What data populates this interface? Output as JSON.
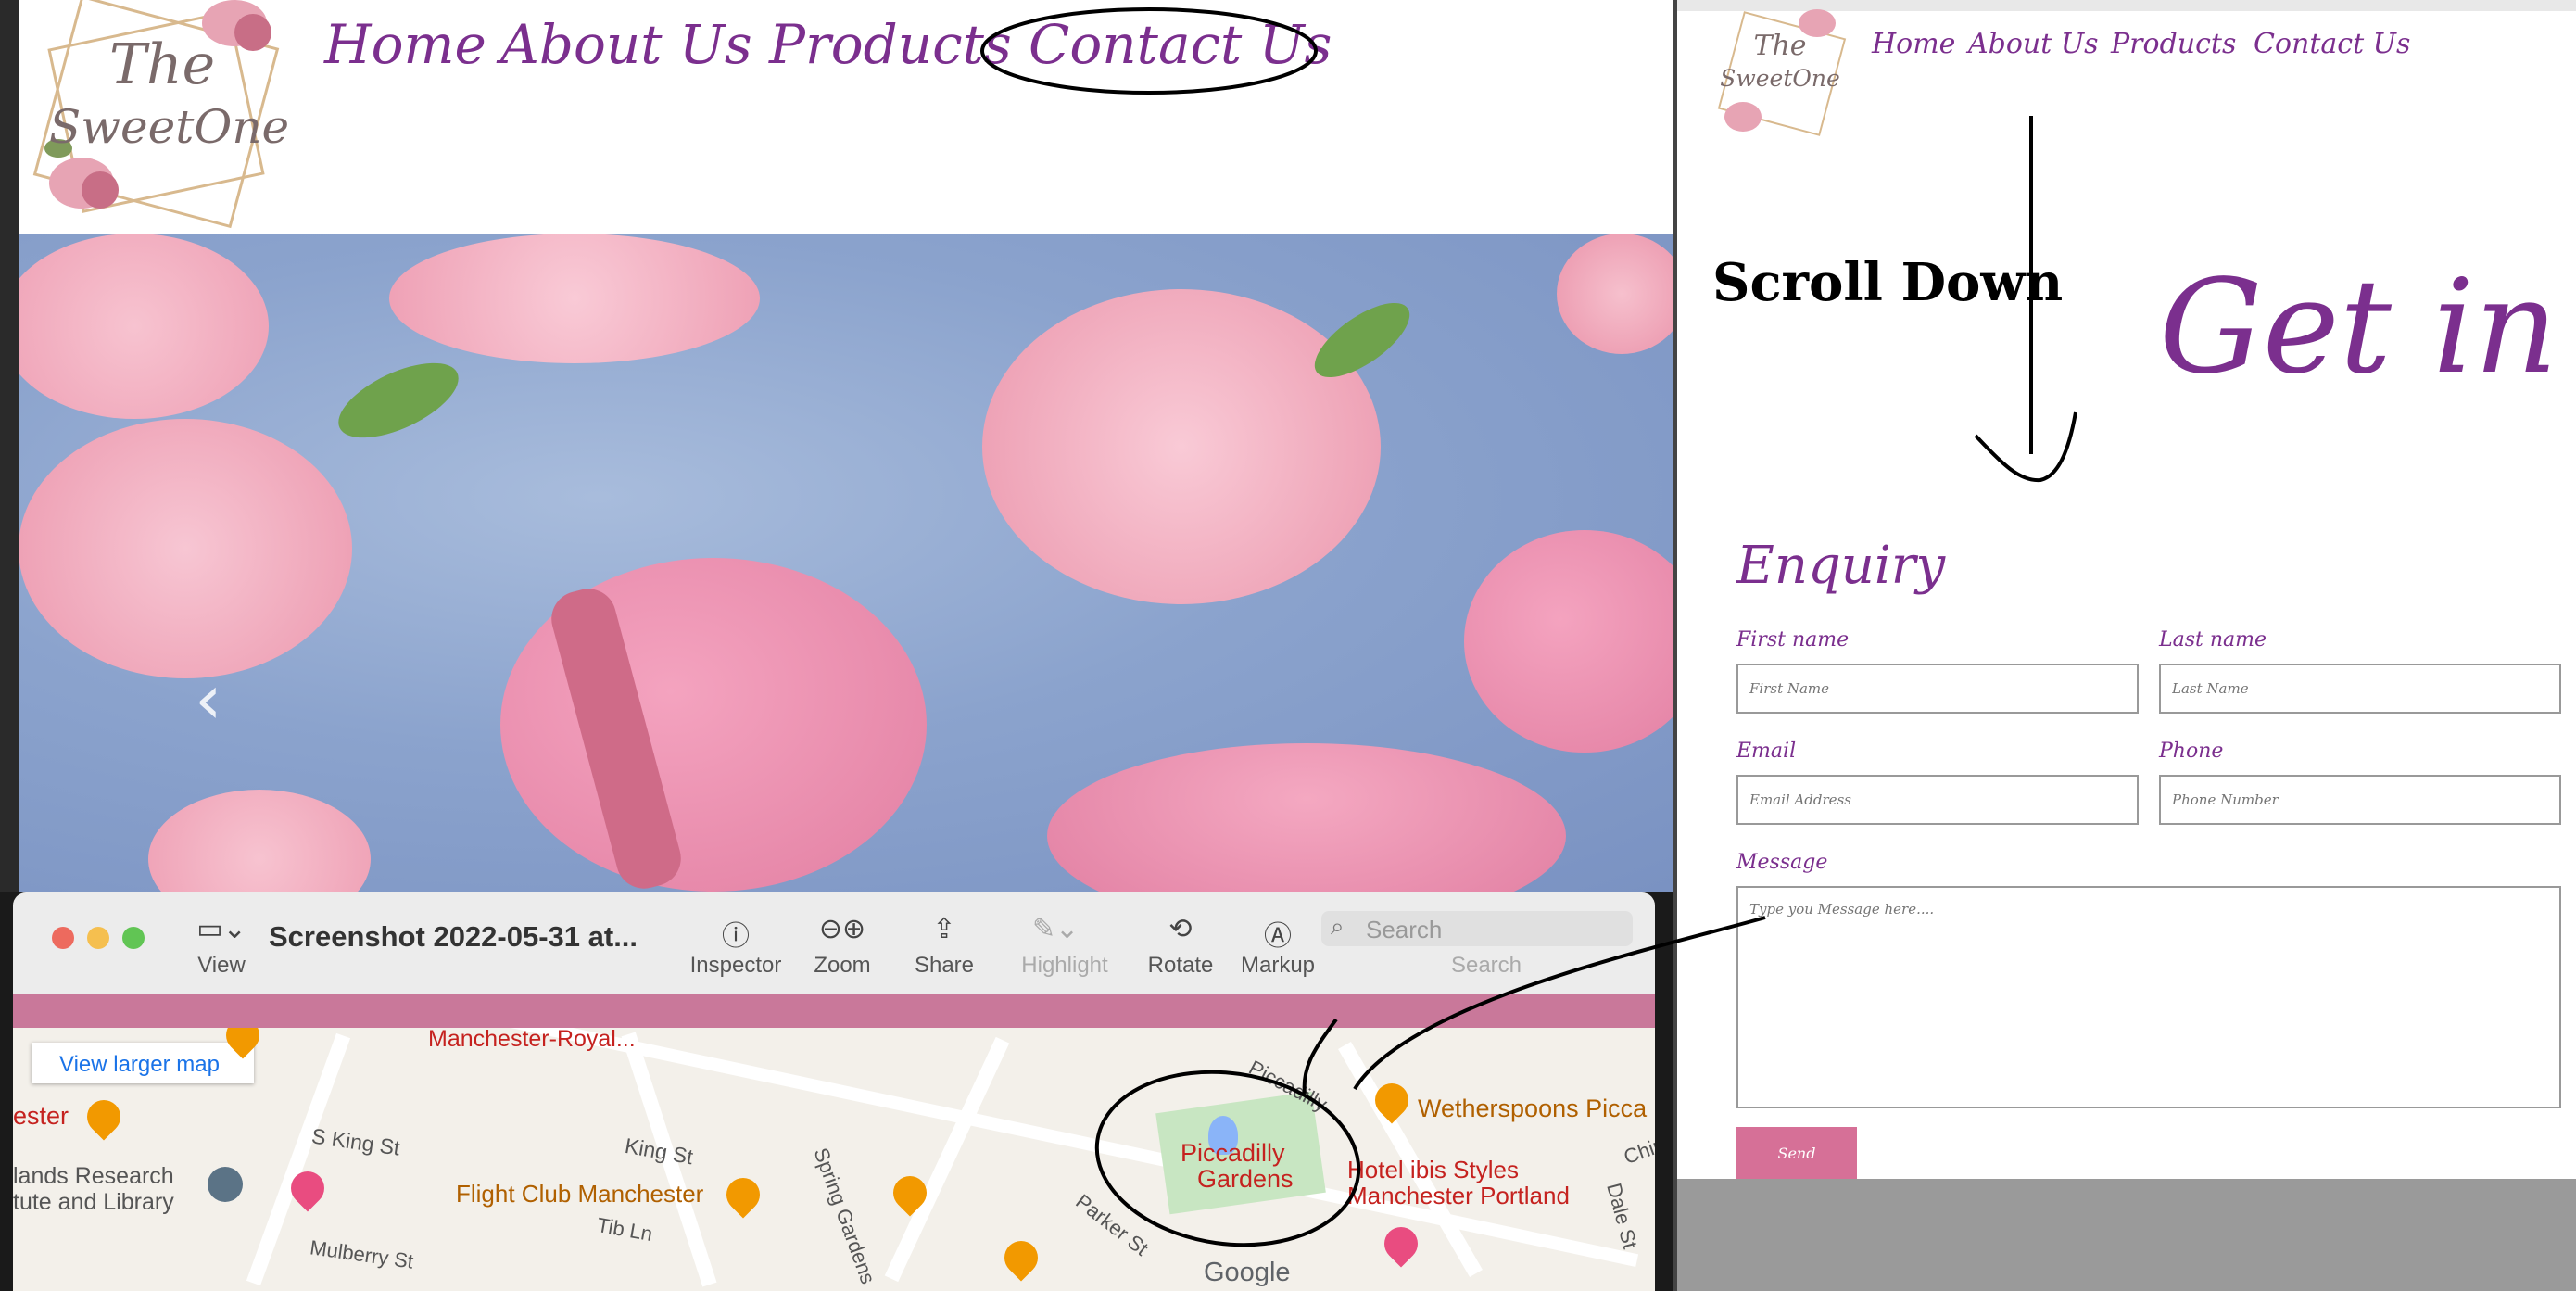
{
  "left_site": {
    "logo_text_line1": "The",
    "logo_text_line2": "SweetOne",
    "nav": [
      {
        "label": "Home"
      },
      {
        "label": "About Us"
      },
      {
        "label": "Products"
      },
      {
        "label": "Contact Us"
      }
    ],
    "carousel_prev_glyph": "‹"
  },
  "preview": {
    "title": "Screenshot 2022-05-31 at...",
    "toolbar": {
      "view": "View",
      "inspector": "Inspector",
      "zoom": "Zoom",
      "share": "Share",
      "highlight": "Highlight",
      "rotate": "Rotate",
      "markup": "Markup",
      "search_label": "Search",
      "search_placeholder": "Search"
    },
    "map": {
      "view_larger": "View larger map",
      "labels": {
        "manchester_royal": "Manchester-Royal...",
        "ester": "ester",
        "s_king": "S King St",
        "king": "King St",
        "flight_club": "Flight Club Manchester",
        "spring_gardens": "Spring Gardens",
        "tib": "Tib Ln",
        "parker": "Parker St",
        "piccadilly": "Piccadilly",
        "piccadilly_gardens_1": "Piccadilly",
        "piccadilly_gardens_2": "Gardens",
        "wetherspoons": "Wetherspoons Picca",
        "ibis_1": "Hotel ibis Styles",
        "ibis_2": "Manchester Portland",
        "research_1": "lands Research",
        "research_2": "tute and Library",
        "mulberry": "Mulberry St",
        "dale": "Dale St",
        "chin": "Chin",
        "google": "Google"
      }
    }
  },
  "annotation": {
    "scroll_down": "Scroll Down"
  },
  "right_site": {
    "nav": [
      {
        "label": "Home"
      },
      {
        "label": "About Us"
      },
      {
        "label": "Products"
      },
      {
        "label": "Contact Us"
      }
    ],
    "logo_text_line1": "The",
    "logo_text_line2": "SweetOne",
    "heading": "Get in T",
    "enquiry": "Enquiry",
    "form": {
      "first_name_label": "First name",
      "first_name_placeholder": "First Name",
      "last_name_label": "Last name",
      "last_name_placeholder": "Last Name",
      "email_label": "Email",
      "email_placeholder": "Email Address",
      "phone_label": "Phone",
      "phone_placeholder": "Phone Number",
      "message_label": "Message",
      "message_placeholder": "Type you Message here....",
      "send": "Send"
    }
  },
  "colors": {
    "brand_purple": "#7b2f8e",
    "pink_button": "#d67097",
    "preview_strip": "#c9789a"
  }
}
